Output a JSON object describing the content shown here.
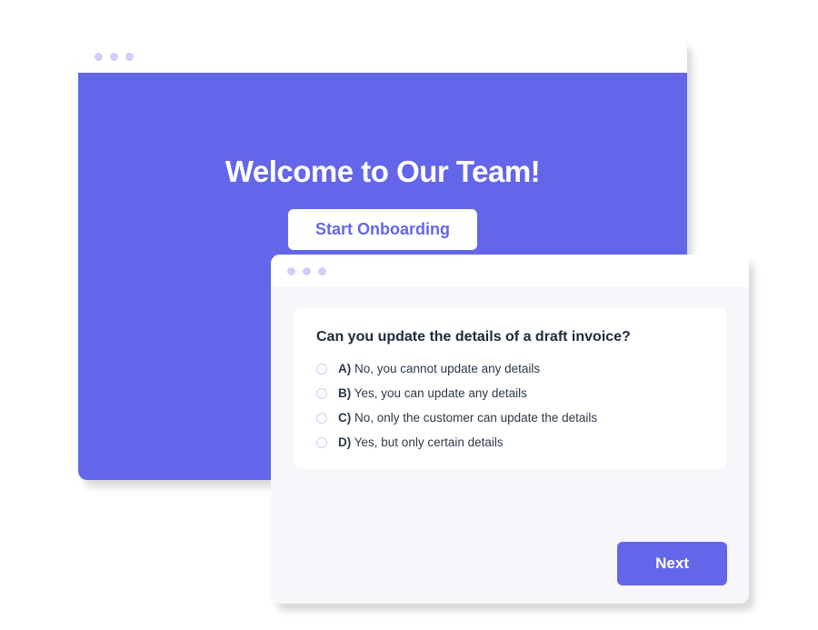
{
  "colors": {
    "accent": "#6466e9",
    "dot": "#cfd0f8",
    "text_dark": "#1c2b3a"
  },
  "welcome": {
    "title": "Welcome to Our Team!",
    "cta_label": "Start Onboarding"
  },
  "quiz": {
    "question": "Can you update the details of a draft invoice?",
    "options": [
      {
        "letter": "A)",
        "text": "No, you cannot update any details"
      },
      {
        "letter": "B)",
        "text": "Yes, you can update any details"
      },
      {
        "letter": "C)",
        "text": "No, only the customer can update the details"
      },
      {
        "letter": "D)",
        "text": "Yes, but only certain details"
      }
    ],
    "next_label": "Next"
  }
}
